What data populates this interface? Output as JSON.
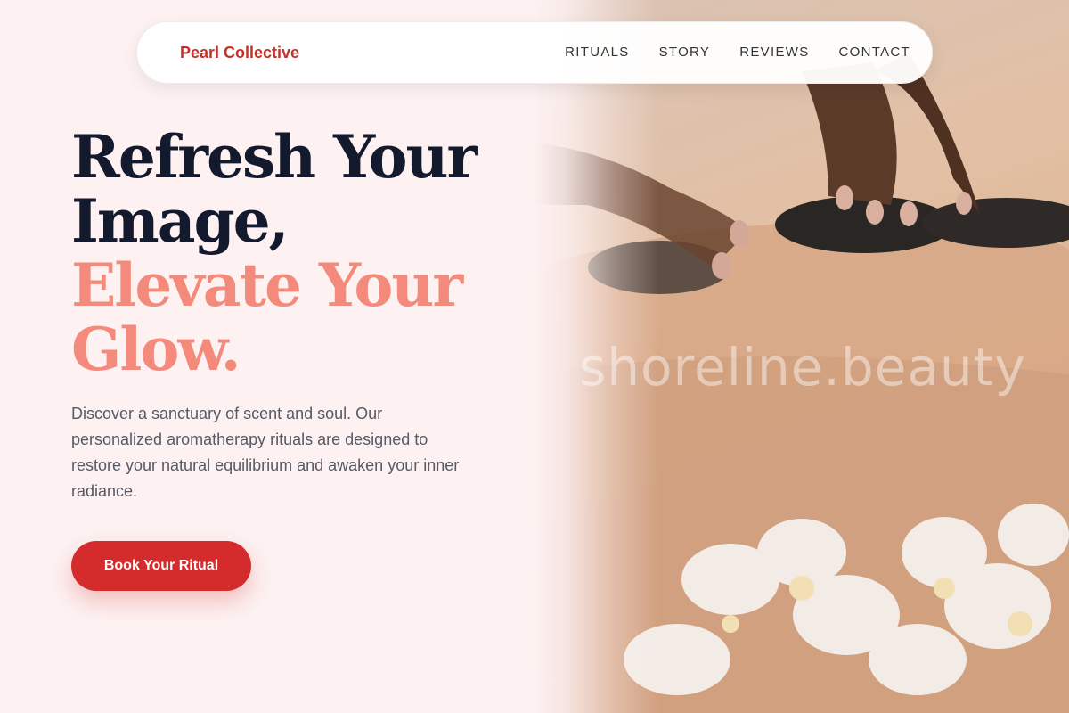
{
  "brand": {
    "name": "Pearl Collective",
    "color": "#c6302b"
  },
  "nav": {
    "items": [
      {
        "label": "RITUALS"
      },
      {
        "label": "STORY"
      },
      {
        "label": "REVIEWS"
      },
      {
        "label": "CONTACT"
      }
    ]
  },
  "hero": {
    "title_line1": "Refresh Your",
    "title_line2": "Image,",
    "title_accent1": "Elevate Your",
    "title_accent2": "Glow.",
    "description": "Discover a sanctuary of scent and soul. Our personalized aromatherapy rituals are designed to restore your natural equilibrium and awaken your inner radiance.",
    "cta_label": "Book Your Ritual",
    "image_subject": "hot-stone-massage-photo",
    "watermark": "shoreline.beauty"
  },
  "colors": {
    "background": "#fdf1f1",
    "heading": "#141a2e",
    "accent": "#f48a7c",
    "cta": "#d42c2c"
  }
}
